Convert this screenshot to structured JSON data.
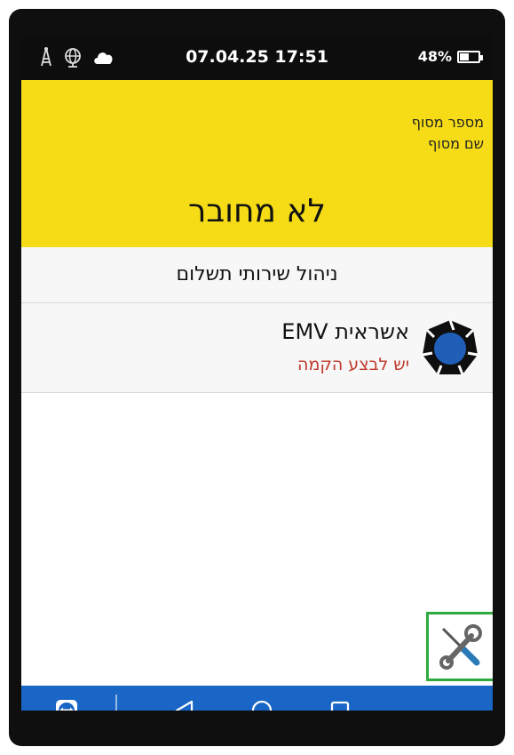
{
  "status_bar": {
    "icons": [
      "signal-tower-icon",
      "globe-icon",
      "cloud-icon"
    ],
    "datetime": "07.04.25 17:51",
    "battery_percent": "48%",
    "battery_level": 0.48
  },
  "header": {
    "terminal_number_label": "מספר מסוף",
    "terminal_name_label": "שם מסוף",
    "connection_status": "לא מחובר",
    "background_color": "#f5dc17"
  },
  "services": {
    "title": "ניהול שירותי תשלום",
    "items": [
      {
        "name": "אשראית EMV",
        "status": "יש לבצע הקמה",
        "status_color": "#c0392b",
        "icon": "emv-logo-icon"
      }
    ]
  },
  "tools": {
    "icon": "tools-wrench-screwdriver-icon",
    "highlight_color": "#2eaa3e"
  },
  "nav_bar": {
    "items": [
      "teamviewer-icon",
      "back-icon",
      "home-icon",
      "recents-icon"
    ],
    "color": "#1966c6"
  }
}
